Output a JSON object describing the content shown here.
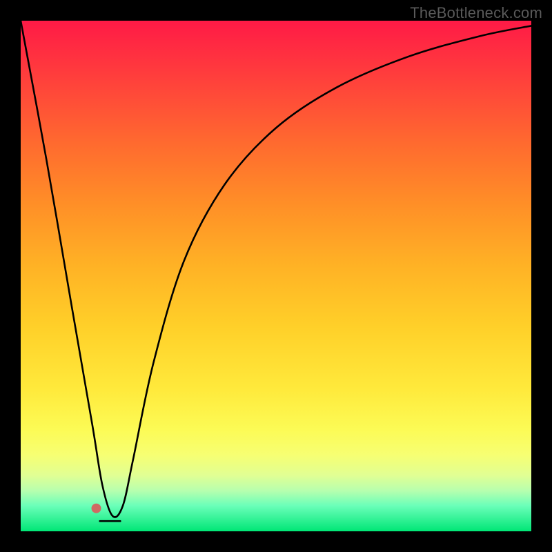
{
  "watermark": "TheBottleneck.com",
  "chart_data": {
    "type": "line",
    "title": "",
    "xlabel": "",
    "ylabel": "",
    "xlim": [
      0,
      100
    ],
    "ylim": [
      0,
      100
    ],
    "grid": false,
    "series": [
      {
        "name": "bottleneck-curve",
        "x": [
          0,
          5,
          10,
          14,
          16,
          18,
          20,
          22,
          26,
          32,
          40,
          50,
          62,
          76,
          90,
          100
        ],
        "values": [
          100,
          73,
          44,
          21,
          9,
          3,
          5,
          14,
          33,
          53,
          68,
          79,
          87,
          93,
          97,
          99
        ]
      }
    ],
    "annotations": [
      {
        "name": "optimal-marker",
        "x_start": 15.5,
        "x_end": 19.5,
        "y": 2
      },
      {
        "name": "optimal-dot",
        "x": 14.8,
        "y": 4.5
      }
    ],
    "background": {
      "type": "vertical-gradient",
      "stops": [
        {
          "pos": 0.0,
          "color": "#ff1a46"
        },
        {
          "pos": 0.36,
          "color": "#ff8f27"
        },
        {
          "pos": 0.72,
          "color": "#ffe93b"
        },
        {
          "pos": 1.0,
          "color": "#00e676"
        }
      ]
    }
  }
}
